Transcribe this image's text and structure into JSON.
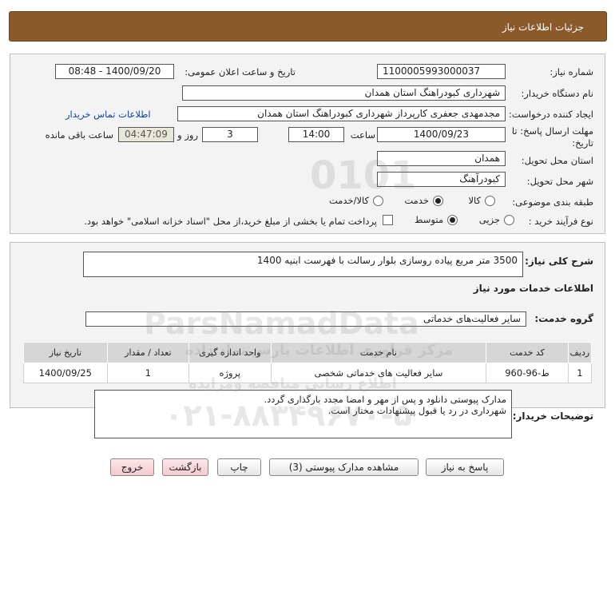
{
  "header": {
    "title": "جزئیات اطلاعات نیاز"
  },
  "form": {
    "need_number_label": "شماره نیاز:",
    "need_number": "1100005993000037",
    "announce_label": "تاریخ و ساعت اعلان عمومی:",
    "announce_value": "1400/09/20 - 08:48",
    "buyer_org_label": "نام دستگاه خریدار:",
    "buyer_org": "شهرداری کبودراهنگ استان همدان",
    "creator_label": "ایجاد کننده درخواست:",
    "creator": "مجدمهدی جعفری کارپرداز شهرداری کبودراهنگ استان همدان",
    "contact_link": "اطلاعات تماس خریدار",
    "deadline_label_1": "مهلت ارسال پاسخ: تا",
    "deadline_label_2": "تاریخ:",
    "deadline_date": "1400/09/23",
    "time_label": "ساعت",
    "deadline_time": "14:00",
    "days_value": "3",
    "days_label": "روز و",
    "remaining_time": "04:47:09",
    "remaining_label": "ساعت باقی مانده",
    "province_label": "استان محل تحویل:",
    "province": "همدان",
    "city_label": "شهر محل تحویل:",
    "city": "کبودرآهنگ",
    "category_label": "طبقه بندی موضوعی:",
    "category_options": [
      "کالا",
      "خدمت",
      "کالا/خدمت"
    ],
    "category_selected": "خدمت",
    "purchase_type_label": "نوع فرآیند خرید :",
    "purchase_options": [
      "جزیی",
      "متوسط"
    ],
    "purchase_selected": "متوسط",
    "payment_note": "پرداخت تمام یا بخشی از مبلغ خرید،از محل \"اسناد خزانه اسلامی\" خواهد بود."
  },
  "description": {
    "label": "شرح کلی نیاز:",
    "value": "3500 متر مربع پیاده روسازی بلوار رسالت با فهرست ابنیه 1400"
  },
  "services": {
    "section_title": "اطلاعات خدمات مورد نیاز",
    "group_label": "گروه خدمت:",
    "group_value": "سایر فعالیت‌های خدماتی",
    "columns": [
      "ردیف",
      "کد خدمت",
      "نام خدمت",
      "واحد اندازه گیری",
      "تعداد / مقدار",
      "تاریخ نیاز"
    ],
    "rows": [
      [
        "1",
        "ط-96-960",
        "سایر فعالیت های خدماتی شخصی",
        "پروژه",
        "1",
        "1400/09/25"
      ]
    ]
  },
  "buyer_notes": {
    "label": "توضیحات خریدار:",
    "line1": "مدارک پیوستی دانلود و پس از مهر و امضا مجدد بارگذاری گردد.",
    "line2": "شهرداری در رد یا قبول پیشنهادات مختار است."
  },
  "buttons": {
    "respond": "پاسخ به نیاز",
    "attachments": "مشاهده مدارک پیوستی (3)",
    "print": "چاپ",
    "back": "بازگشت",
    "exit": "خروج"
  },
  "watermark": {
    "brand": "ParsNamadData",
    "phone": "۰۲۱-۸۸۳۴۹۶۷۰-۵",
    "tagline": "مرکز فراوری اطلاعات پارس نماد داده",
    "tagline2": "اطلاع رسانی مناقصه ومزایده",
    "digits": "0101"
  }
}
